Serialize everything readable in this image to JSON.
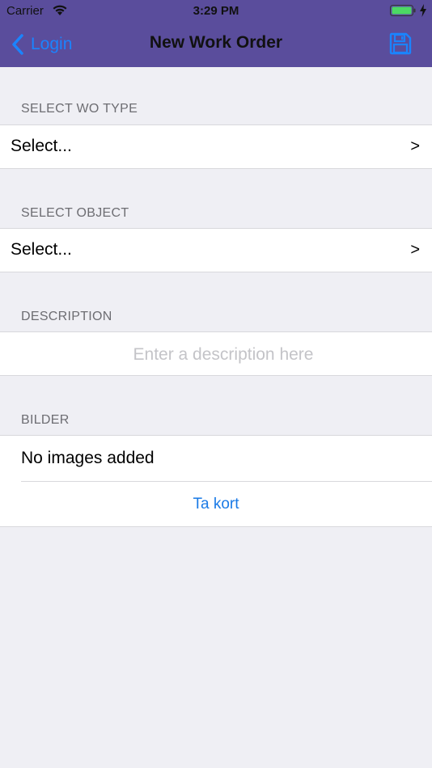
{
  "status_bar": {
    "carrier": "Carrier",
    "time": "3:29 PM"
  },
  "nav": {
    "back_label": "Login",
    "title": "New Work Order",
    "save_icon": "floppy-disk-icon",
    "back_icon": "chevron-left-icon"
  },
  "colors": {
    "nav_bg": "#5a4d9c",
    "link_blue": "#1a84ff",
    "page_bg": "#efeff4",
    "battery_green": "#4cd964"
  },
  "sections": {
    "wo_type": {
      "header": "SELECT WO TYPE",
      "value": "Select...",
      "chevron": ">"
    },
    "object": {
      "header": "SELECT OBJECT",
      "value": "Select...",
      "chevron": ">"
    },
    "description": {
      "header": "DESCRIPTION",
      "placeholder": "Enter a description here",
      "value": ""
    },
    "images": {
      "header": "BILDER",
      "empty_text": "No images added",
      "action_label": "Ta kort"
    }
  }
}
